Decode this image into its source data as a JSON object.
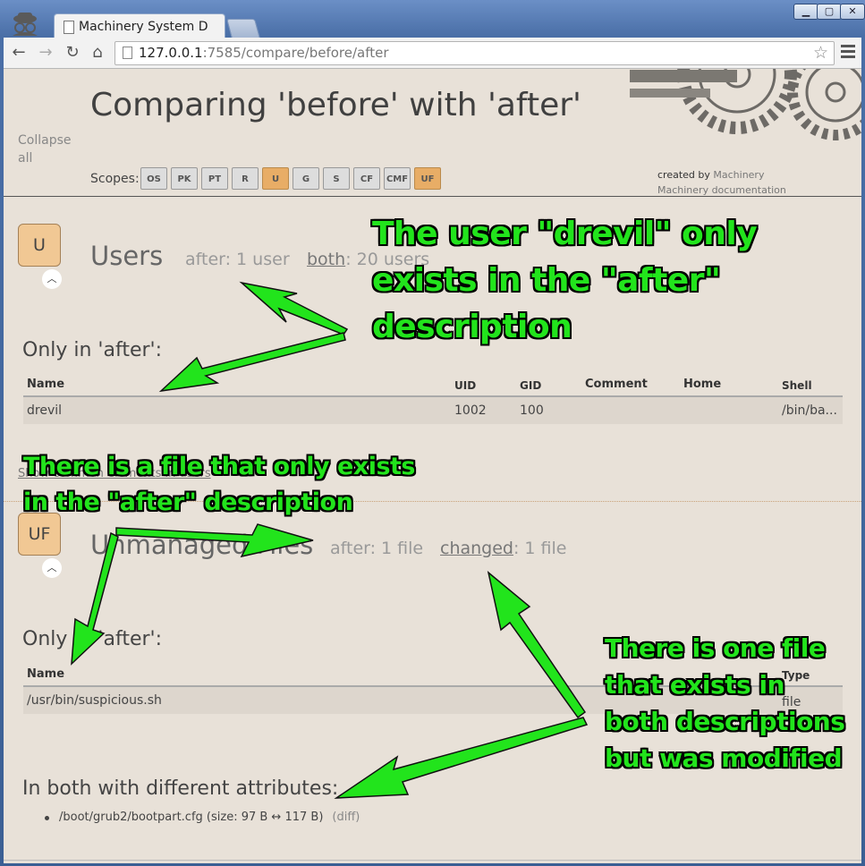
{
  "browser": {
    "tab_title": "Machinery System D",
    "url_host": "127.0.0.1",
    "url_rest": ":7585/compare/before/after",
    "window_buttons": [
      "▁",
      "▢",
      "✕"
    ]
  },
  "header": {
    "title": "Comparing 'before' with 'after'",
    "collapse_all": "Collapse all",
    "scopes_label": "Scopes:",
    "scopes": [
      "OS",
      "PK",
      "PT",
      "R",
      "U",
      "G",
      "S",
      "CF",
      "CMF",
      "UF"
    ],
    "active_scopes": [
      "U",
      "UF"
    ],
    "created_by_prefix": "created by",
    "created_by_link": "Machinery",
    "documentation_link": "Machinery documentation"
  },
  "users": {
    "badge": "U",
    "title": "Users",
    "after_stat": "after: 1 user",
    "both_link": "both",
    "both_count": ": 20 users",
    "only_heading": "Only in 'after':",
    "columns": [
      "Name",
      "UID",
      "GID",
      "Comment",
      "Home",
      "Shell"
    ],
    "rows": [
      {
        "name": "drevil",
        "uid": "1002",
        "gid": "100",
        "comment": "",
        "home": "",
        "shell": "/bin/ba..."
      }
    ],
    "show_common": "Show common elements in users"
  },
  "unmanaged_files": {
    "badge": "UF",
    "title": "Unmanaged Files",
    "after_stat": "after: 1 file",
    "changed_link": "changed",
    "changed_count": ": 1 file",
    "only_heading": "Only in 'after':",
    "columns": [
      "Name",
      "Type"
    ],
    "rows": [
      {
        "name": "/usr/bin/suspicious.sh",
        "type": "file"
      }
    ],
    "diff_heading": "In both with different attributes:",
    "diff_item": "/boot/grub2/bootpart.cfg (size: 97 B ↔ 117 B)",
    "diff_link": "(diff)"
  },
  "annotations": {
    "user_lines": [
      "The user \"drevil\" only",
      "exists in the \"after\"",
      "description"
    ],
    "file_lines": [
      "There is a file that only exists",
      "in the \"after\" description"
    ],
    "changed_lines": [
      "There is one file",
      "that exists in",
      "both descriptions",
      "but was modified"
    ],
    "color": "#22e41c"
  },
  "colors": {
    "page_bg": "#e8e1d8",
    "scope_active": "#e8ad66",
    "badge": "#f1c894"
  }
}
